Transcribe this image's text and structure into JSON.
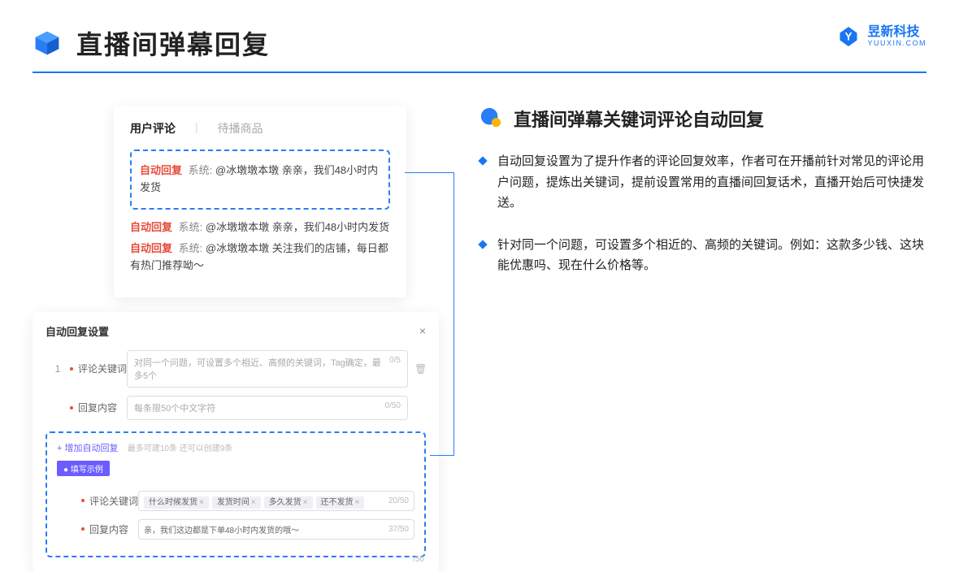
{
  "header": {
    "title": "直播间弹幕回复"
  },
  "brand": {
    "cn": "昱新科技",
    "en": "YUUXIN.COM"
  },
  "comments": {
    "tab_active": "用户评论",
    "tab_inactive": "待播商品",
    "auto_reply_label": "自动回复",
    "sys_label": "系统:",
    "highlighted": "@冰墩墩本墩 亲亲，我们48小时内发货",
    "item2": "@冰墩墩本墩 亲亲，我们48小时内发货",
    "item3": "@冰墩墩本墩 关注我们的店铺，每日都有热门推荐呦～"
  },
  "settings": {
    "title": "自动回复设置",
    "row_num": "1",
    "keyword_label": "评论关键词",
    "keyword_placeholder": "对同一个问题，可设置多个相近、高频的关键词，Tag确定，最多5个",
    "keyword_count": "0/5",
    "content_label": "回复内容",
    "content_placeholder": "每条限50个中文字符",
    "content_count": "0/50",
    "add_link": "+ 增加自动回复",
    "add_hint": "最多可建10条 还可以创建9条",
    "example_badge": "● 填写示例",
    "ex_keyword_label": "评论关键词",
    "ex_tags": [
      "什么时候发货",
      "发货时间",
      "多久发货",
      "还不发货"
    ],
    "ex_keyword_count": "20/50",
    "ex_content_label": "回复内容",
    "ex_content_text": "亲，我们这边都是下单48小时内发货的哦～",
    "ex_content_count": "37/50",
    "stray_count": "/50"
  },
  "right": {
    "section_title": "直播间弹幕关键词评论自动回复",
    "bullet1": "自动回复设置为了提升作者的评论回复效率，作者可在开播前针对常见的评论用户问题，提炼出关键词，提前设置常用的直播间回复话术，直播开始后可快捷发送。",
    "bullet2": "针对同一个问题，可设置多个相近的、高频的关键词。例如：这款多少钱、这块能优惠吗、现在什么价格等。"
  }
}
